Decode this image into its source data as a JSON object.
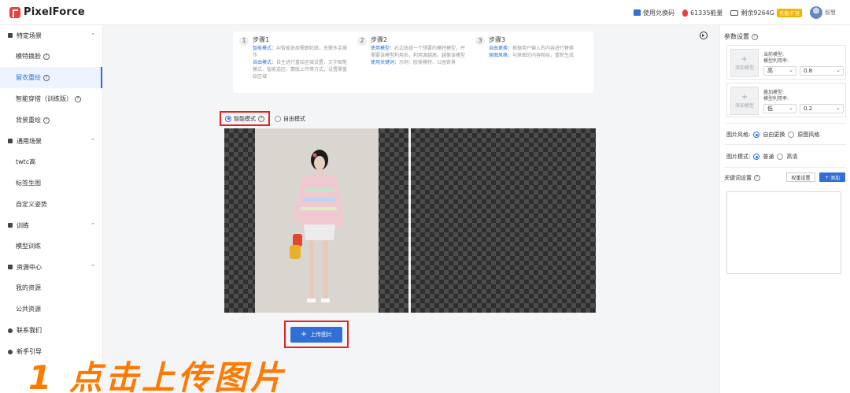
{
  "app": {
    "logo_text": "PixelForce"
  },
  "topbar": {
    "redeem_label": "使用兑换码",
    "energy_label": "61335能量",
    "storage_label": "剩余9264G",
    "vip_badge": "充值/扩容",
    "user_name": "智慧"
  },
  "sidebar": {
    "group_specific": "特定场景",
    "item_model_face": "模特换脸",
    "item_repaint": "留衣重绘",
    "item_smart_wear": "智能穿搭（训练版）",
    "item_bg_repaint": "背景重绘",
    "group_general": "通用场景",
    "item_upscale": "twtc高",
    "item_label": "标签生图",
    "item_pose": "自定义姿势",
    "group_train": "训练",
    "item_model_train": "模型训练",
    "group_resources": "资源中心",
    "item_my_res": "我的资源",
    "item_public_res": "公共资源",
    "item_contact": "联系我们",
    "item_guide": "新手引导"
  },
  "steps": [
    {
      "num": "1",
      "title": "步骤1",
      "lines": [
        {
          "hl": "智能模式：",
          "text": "AI智能选择需跟轮廓，无需多余操作"
        },
        {
          "hl": "自由模式：",
          "text": "自主进行重绘区域设置，文字图笔模式、智能选区、蒙版上传等方式，设置需重绘区域"
        }
      ]
    },
    {
      "num": "2",
      "title": "步骤2",
      "lines": [
        {
          "hl": "使用模型：",
          "text": "右边选择一个想要的模特模型，并需要该模型利用系，利用源越高，越像该模型"
        },
        {
          "hl": "使用关键词：",
          "text": "示例：欧美模特、公园背景"
        }
      ]
    },
    {
      "num": "3",
      "title": "步骤3",
      "lines": [
        {
          "hl": "自由更换：",
          "text": "根据用户输入的内容进行替换"
        },
        {
          "hl": "原图风格：",
          "text": "与原图的内容相似，重新生成"
        }
      ]
    }
  ],
  "mode": {
    "smart": "智能模式",
    "free": "自由模式"
  },
  "upload": {
    "label": "上传图片"
  },
  "caption": "1 点击上传图片",
  "rpanel": {
    "title": "参数设置",
    "current_model_label": "当前模型:",
    "current_weight_label": "模型利用率:",
    "current_level": "高",
    "current_value": "0.8",
    "overlay_model_label": "叠加模型:",
    "overlay_weight_label": "模型利用率:",
    "overlay_level": "低",
    "overlay_value": "0.2",
    "add_model": "添加模型",
    "style_label": "图片风格:",
    "style_opt1": "自由更换",
    "style_opt2": "原图风格",
    "mode_label": "图片模式:",
    "mode_opt1": "普通",
    "mode_opt2": "高清",
    "keyword_label": "关键词设置",
    "weight_btn": "权重设置",
    "add_btn": "添加"
  }
}
